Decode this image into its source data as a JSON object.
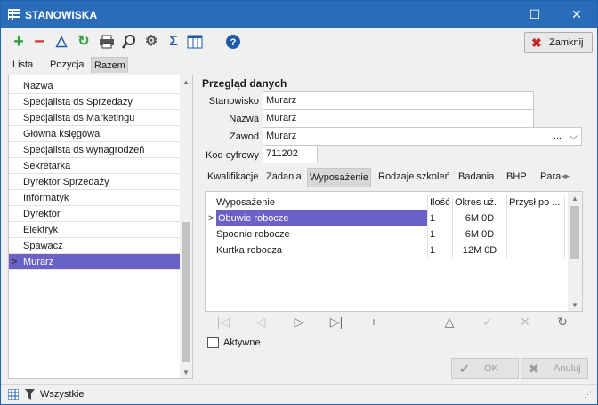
{
  "window": {
    "title": "STANOWISKA",
    "maximize_glyph": "☐",
    "close_glyph": "✕"
  },
  "toolbar": {
    "icons": [
      "add-icon",
      "remove-icon",
      "filter-icon",
      "refresh-icon",
      "print-icon",
      "search-icon",
      "settings-icon",
      "sum-icon",
      "columns-icon",
      "help-icon"
    ],
    "close_label": "Zamknij"
  },
  "view_tabs": [
    "Lista",
    "Pozycja",
    "Razem"
  ],
  "list": {
    "header": "Nazwa",
    "items": [
      "Specjalista ds Sprzedaży",
      "Specjalista ds Marketingu",
      "Główna księgowa",
      "Specjalista ds wynagrodzeń",
      "Sekretarka",
      "Dyrektor Sprzedaży",
      "Informatyk",
      "Dyrektor",
      "Elektryk",
      "Spawacz",
      "Murarz"
    ],
    "selected": "Murarz"
  },
  "details": {
    "title": "Przegląd danych",
    "fields": [
      {
        "label": "Stanowisko",
        "value": "Murarz"
      },
      {
        "label": "Nazwa",
        "value": "Murarz"
      },
      {
        "label": "Zawod",
        "value": "Murarz"
      },
      {
        "label": "Kod cyfrowy",
        "value": "711202"
      }
    ],
    "zawod_ellipsis": "...",
    "tabs": [
      "Kwalifikacje",
      "Zadania",
      "Wyposażenie",
      "Rodzaje szkoleń",
      "Badania",
      "BHP",
      "Para"
    ],
    "active_tab": "Wyposażenie"
  },
  "equipment_table": {
    "columns": [
      "Wyposażenie",
      "Ilość",
      "Okres uż.",
      "Przysł.po ..."
    ],
    "rows": [
      [
        "Obuwie robocze",
        "1",
        "6M 0D",
        ""
      ],
      [
        "Spodnie robocze",
        "1",
        "6M 0D",
        ""
      ],
      [
        "Kurtka robocza",
        "1",
        "12M 0D",
        ""
      ]
    ]
  },
  "navigator": [
    "|◁",
    "◁",
    "▷",
    "▷|",
    "+",
    "−",
    "△",
    "✓",
    "✕",
    "↻"
  ],
  "checkbox": {
    "label": "Aktywne",
    "checked": false
  },
  "buttons": {
    "ok": "OK",
    "cancel": "Anuluj"
  },
  "status": {
    "filter_text": "Wszystkie"
  },
  "colors": {
    "title_bar": "#2b6cb8",
    "selection": "#6a62c7",
    "add": "#2e9e3e",
    "remove": "#d32f2f",
    "accent": "#1e5aa8"
  }
}
